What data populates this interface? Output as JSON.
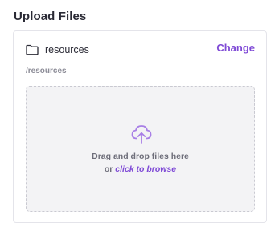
{
  "header": {
    "title": "Upload Files"
  },
  "folder": {
    "icon": "folder-icon",
    "name": "resources",
    "path": "/resources",
    "change_label": "Change"
  },
  "dropzone": {
    "icon": "cloud-upload-icon",
    "line1": "Drag and drop files here",
    "line2_prefix": "or",
    "browse_label": "click to browse"
  },
  "colors": {
    "accent": "#7f4ad6",
    "dropzone_background": "#f3f3f5",
    "dropzone_border": "#c9c9d1",
    "muted_text": "#8c8c97"
  }
}
